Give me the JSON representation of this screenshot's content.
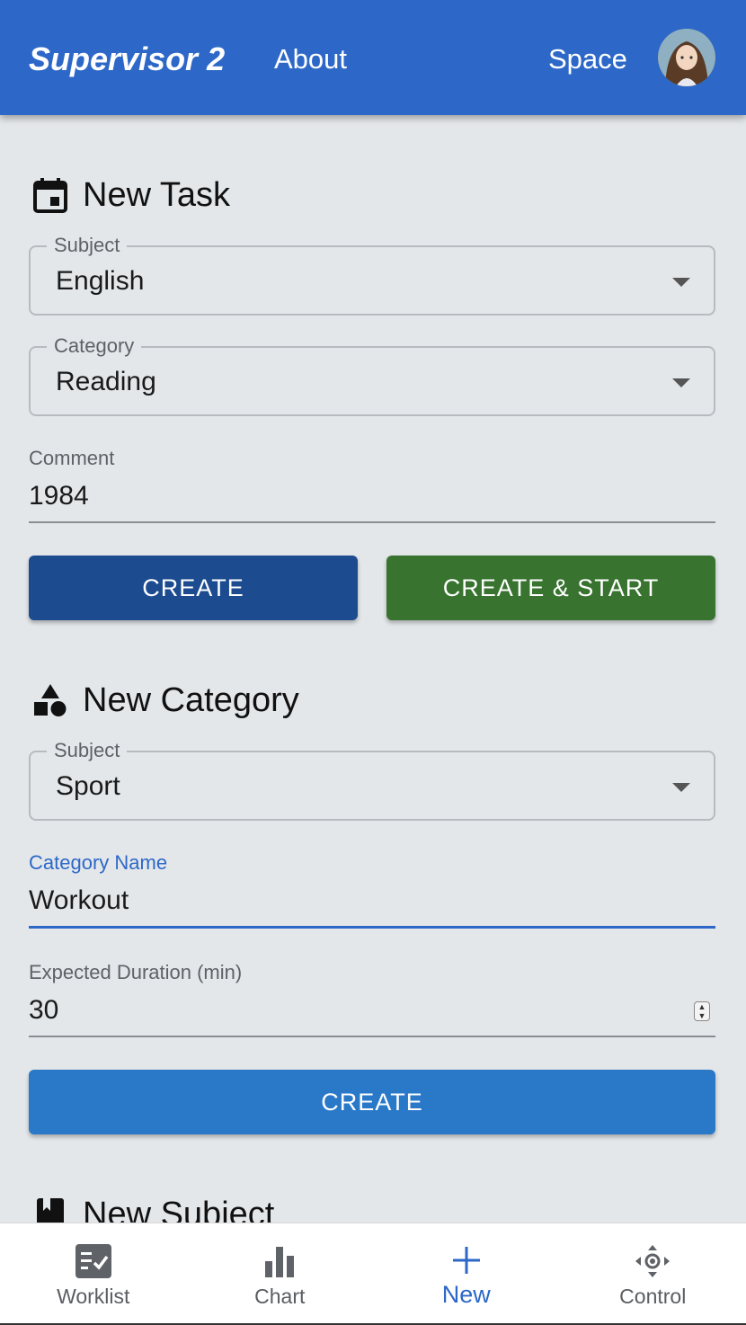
{
  "header": {
    "brand": "Supervisor 2",
    "about": "About",
    "space": "Space"
  },
  "new_task": {
    "title": "New Task",
    "subject_label": "Subject",
    "subject_value": "English",
    "category_label": "Category",
    "category_value": "Reading",
    "comment_label": "Comment",
    "comment_value": "1984",
    "create_label": "CREATE",
    "create_start_label": "CREATE & START"
  },
  "new_category": {
    "title": "New Category",
    "subject_label": "Subject",
    "subject_value": "Sport",
    "name_label": "Category Name",
    "name_value": "Workout",
    "duration_label": "Expected Duration (min)",
    "duration_value": "30",
    "create_label": "CREATE"
  },
  "new_subject": {
    "title": "New Subject"
  },
  "bottom_nav": {
    "items": [
      {
        "label": "Worklist",
        "icon": "worklist-icon"
      },
      {
        "label": "Chart",
        "icon": "bar-chart-icon"
      },
      {
        "label": "New",
        "icon": "plus-icon",
        "active": true
      },
      {
        "label": "Control",
        "icon": "control-icon"
      }
    ]
  },
  "colors": {
    "app_bar": "#2d68c8",
    "background": "#e4e7ea",
    "create_dark": "#1d4b8f",
    "create_start": "#38732f",
    "create_primary": "#2a78c8",
    "active_nav": "#2d68c8"
  }
}
